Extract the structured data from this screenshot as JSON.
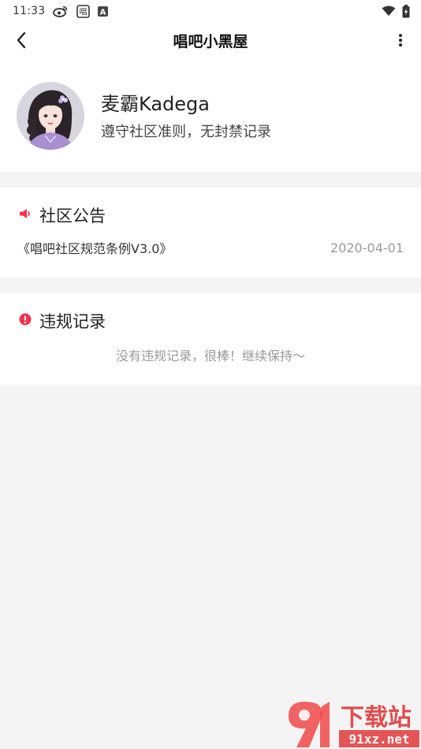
{
  "status_bar": {
    "time": "11:33",
    "icons": [
      "weibo-icon",
      "chang-app-icon",
      "a-app-icon",
      "wifi-icon",
      "battery-charging-icon"
    ],
    "chang_badge": "唱",
    "a_badge": "A"
  },
  "nav": {
    "title": "唱吧小黑屋",
    "back_icon": "chevron-left-icon",
    "more_icon": "more-vertical-icon"
  },
  "profile": {
    "name": "麦霸Kadega",
    "status": "遵守社区准则，无封禁记录"
  },
  "notice": {
    "title": "社区公告",
    "icon": "speaker-icon",
    "item_title": "《唱吧社区规范条例V3.0》",
    "item_date": "2020-04-01"
  },
  "violations": {
    "title": "违规记录",
    "icon": "alert-circle-icon",
    "empty_text": "没有违规记录，很棒！继续保持～"
  },
  "watermark": {
    "title": "下载站",
    "url": "91xz.net"
  },
  "colors": {
    "accent": "#f0344f",
    "background": "#f4f4f4",
    "card": "#ffffff"
  }
}
